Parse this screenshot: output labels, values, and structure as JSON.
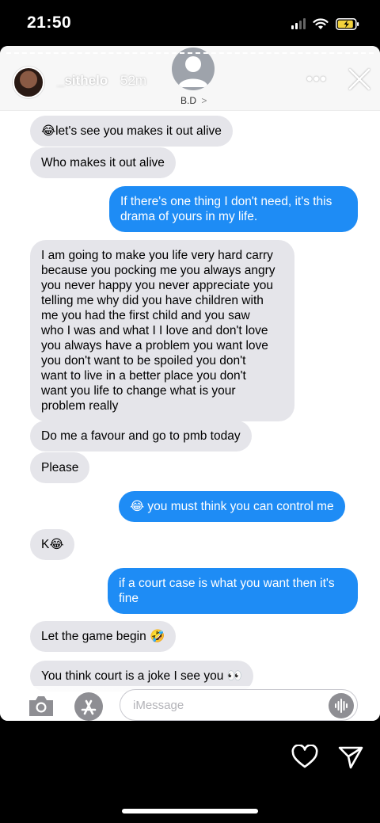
{
  "status": {
    "time": "21:50"
  },
  "story": {
    "username": "_sithelo",
    "time_ago": "52m",
    "contact_name": "B.D",
    "contact_chevron": ">",
    "more_label": "•••"
  },
  "messages": [
    {
      "side": "in",
      "text": "😂let's see you makes it out alive"
    },
    {
      "side": "in",
      "text": "Who makes it out alive"
    },
    {
      "side": "out",
      "text": "If there's one thing I don't need, it's this\ndrama of yours in my life."
    },
    {
      "side": "in",
      "text": "I am going to make you life very hard carry\nbecause you pocking me you always angry\nyou never happy you never appreciate you\ntelling me why did you have children with\nme you had the first child and you saw\nwho I was and what I I love and don't love\nyou always have a problem you want love\nyou don't want to be spoiled you don't\nwant to live in a better place you don't\nwant you life to change what is your\nproblem really"
    },
    {
      "side": "in",
      "text": "Do me a favour and go to pmb today"
    },
    {
      "side": "in",
      "text": "Please"
    },
    {
      "side": "out",
      "text": "😂 you must think you can control me"
    },
    {
      "side": "in",
      "text": "K😂"
    },
    {
      "side": "out",
      "text": "if a court case is what you want then it's\nfine"
    },
    {
      "side": "in",
      "text": "Let the game begin 🤣"
    },
    {
      "side": "in",
      "text": "You think court is a joke I see you 👀"
    }
  ],
  "composer": {
    "placeholder": "iMessage"
  },
  "icons": {
    "camera": "camera-icon",
    "appstore": "appstore-icon",
    "audio": "audio-waveform-icon",
    "heart": "heart-icon",
    "send": "send-icon",
    "close": "close-icon"
  },
  "colors": {
    "outgoing": "#1e8cf5",
    "incoming": "#e5e5ea"
  }
}
